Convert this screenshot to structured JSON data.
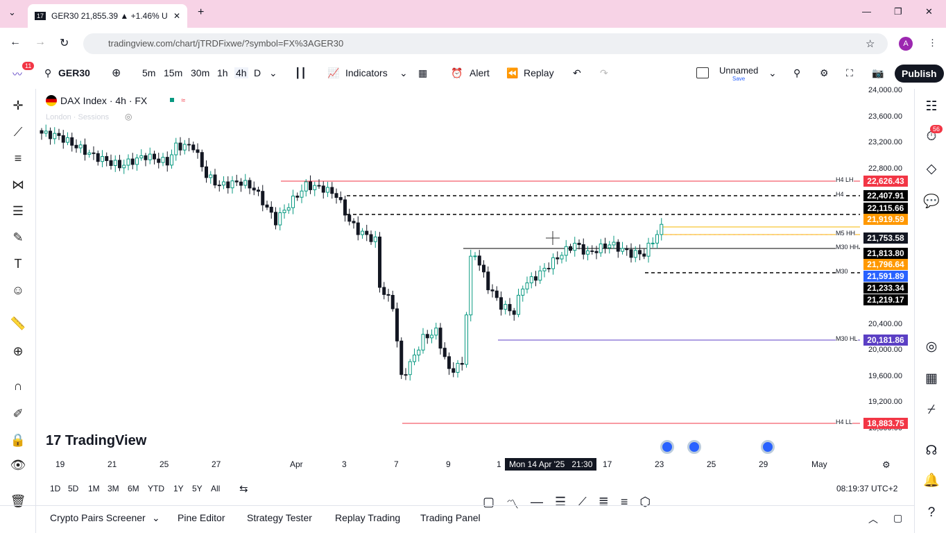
{
  "browser": {
    "tab_title": "GER30 21,855.39 ▲ +1.46% U",
    "url": "tradingview.com/chart/jTRDFixwe/?symbol=FX%3AGER30",
    "profile": "A"
  },
  "toolbar": {
    "badge": "11",
    "symbol": "GER30",
    "intervals": [
      "5m",
      "15m",
      "30m",
      "1h",
      "4h",
      "D"
    ],
    "indicators": "Indicators",
    "alert": "Alert",
    "replay": "Replay",
    "layout_name": "Unnamed",
    "layout_sub": "Save",
    "publish": "Publish"
  },
  "legend": {
    "title": "DAX Index · 4h · FX",
    "sub": "London · Sessions"
  },
  "price_axis": {
    "ticks": [
      "24,000.00",
      "23,600.00",
      "23,200.00",
      "22,800.00",
      "20,400.00",
      "20,000.00",
      "19,600.00",
      "19,200.00",
      "18,800.00"
    ]
  },
  "levels": [
    {
      "name": "H4 LH",
      "value": "22,626.43",
      "color": "#f23645"
    },
    {
      "name": "H4",
      "value": "22,407.91",
      "color": "#000000"
    },
    {
      "name": "",
      "value": "22,115.66",
      "color": "#000000"
    },
    {
      "name": "",
      "value": "21,919.59",
      "color": "#ff9800"
    },
    {
      "name": "M5 HH",
      "value": "21,753.58",
      "color": "#131722"
    },
    {
      "name": "M30 HH",
      "value": "21,813.80",
      "color": "#000000"
    },
    {
      "name": "",
      "value": "21,796.64",
      "color": "#ff9800"
    },
    {
      "name": "",
      "value": "21,591.89",
      "color": "#2962ff"
    },
    {
      "name": "M30",
      "value": "21,233.34",
      "color": "#000000"
    },
    {
      "name": "",
      "value": "21,219.17",
      "color": "#000000"
    },
    {
      "name": "M30 HL",
      "value": "20,181.86",
      "color": "#5b3fc4"
    },
    {
      "name": "H4 LL",
      "value": "18,883.75",
      "color": "#f23645"
    }
  ],
  "time_axis": {
    "ticks": [
      "19",
      "21",
      "25",
      "27",
      "Apr",
      "3",
      "7",
      "9",
      "1",
      "17",
      "23",
      "25",
      "29",
      "May"
    ],
    "crosshair": "Mon 14 Apr '25   21:30"
  },
  "ranges": [
    "1D",
    "5D",
    "1M",
    "3M",
    "6M",
    "YTD",
    "1Y",
    "5Y",
    "All"
  ],
  "clock": "08:19:37 UTC+2",
  "logo": "TradingView",
  "bottom_tabs": [
    "Crypto Pairs Screener",
    "Pine Editor",
    "Strategy Tester",
    "Replay Trading",
    "Trading Panel"
  ],
  "right_badge": "56",
  "colors": {
    "up": "#089981",
    "down": "#131722",
    "accent": "#2962ff"
  },
  "chart_data": {
    "type": "candlestick",
    "title": "DAX Index · 4h · FX",
    "ylim": [
      18800,
      24000
    ],
    "path": [
      [
        0,
        23350
      ],
      [
        4,
        23300
      ],
      [
        12,
        23000
      ],
      [
        18,
        22850
      ],
      [
        24,
        23000
      ],
      [
        29,
        22900
      ],
      [
        31,
        23150
      ],
      [
        35,
        23150
      ],
      [
        38,
        22700
      ],
      [
        41,
        22550
      ],
      [
        46,
        22600
      ],
      [
        49,
        22500
      ],
      [
        54,
        22000
      ],
      [
        57,
        22250
      ],
      [
        61,
        22550
      ],
      [
        65,
        22500
      ],
      [
        68,
        22400
      ],
      [
        71,
        22000
      ],
      [
        73,
        21850
      ],
      [
        77,
        21700
      ],
      [
        78,
        21000
      ],
      [
        81,
        20700
      ],
      [
        83,
        19600
      ],
      [
        85,
        19800
      ],
      [
        88,
        20200
      ],
      [
        91,
        20300
      ],
      [
        94,
        19700
      ],
      [
        97,
        19800
      ],
      [
        99,
        21400
      ],
      [
        100,
        21500
      ],
      [
        103,
        21000
      ],
      [
        106,
        20700
      ],
      [
        109,
        20600
      ],
      [
        111,
        21000
      ],
      [
        115,
        21200
      ],
      [
        120,
        21500
      ],
      [
        123,
        21650
      ],
      [
        126,
        21500
      ],
      [
        131,
        21650
      ],
      [
        136,
        21500
      ],
      [
        139,
        21500
      ],
      [
        141,
        21700
      ],
      [
        143,
        21900
      ]
    ]
  }
}
